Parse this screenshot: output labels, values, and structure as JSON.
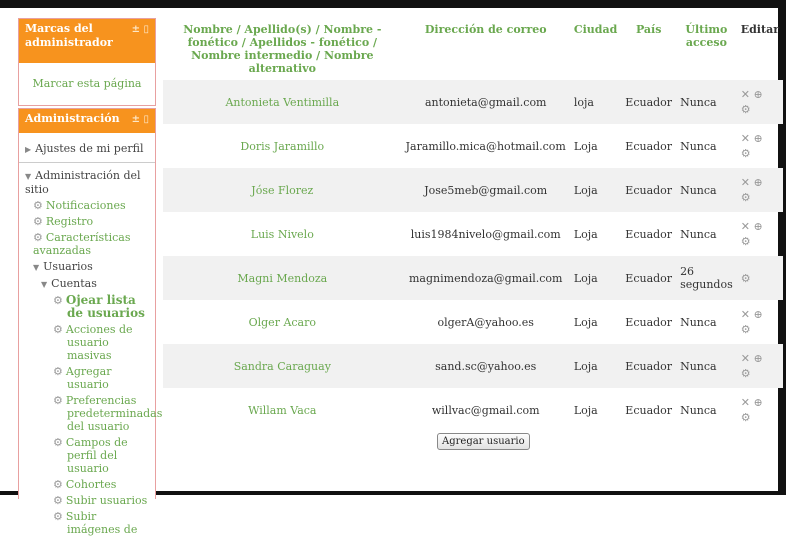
{
  "bookmarks_block": {
    "title": "Marcas del administrador",
    "controls": "± ▯",
    "link": "Marcar esta página"
  },
  "admin_block": {
    "title": "Administración",
    "controls": "± ▯",
    "profile_settings": "Ajustes de mi perfil",
    "site_admin": "Administración del sitio",
    "notifications": "Notificaciones",
    "registry": "Registro",
    "advanced": "Características avanzadas",
    "users": "Usuarios",
    "accounts": "Cuentas",
    "browse_users": "Ojear lista de usuarios",
    "bulk_actions": "Acciones de usuario masivas",
    "add_user": "Agregar usuario",
    "default_prefs": "Preferencias predeterminadas del usuario",
    "profile_fields": "Campos de perfil del usuario",
    "cohorts": "Cohortes",
    "upload_users": "Subir usuarios",
    "upload_pictures": "Subir imágenes de"
  },
  "table": {
    "headers": {
      "name": "Nombre / Apellido(s) / Nombre - fonético / Apellidos - fonético / Nombre intermedio / Nombre alternativo",
      "email": "Dirección de correo",
      "city": "Ciudad",
      "country": "País",
      "last_access": "Último acceso",
      "edit": "Editar"
    },
    "rows": [
      {
        "name": "Antonieta Ventimilla",
        "email": "antonieta@gmail.com",
        "city": "loja",
        "country": "Ecuador",
        "access": "Nunca",
        "edit1": "✕ ⊕",
        "edit2": "⚙"
      },
      {
        "name": "Doris Jaramillo",
        "email": "Jaramillo.mica@hotmail.com",
        "city": "Loja",
        "country": "Ecuador",
        "access": "Nunca",
        "edit1": "✕ ⊕",
        "edit2": "⚙"
      },
      {
        "name": "Jóse Florez",
        "email": "Jose5meb@gmail.com",
        "city": "Loja",
        "country": "Ecuador",
        "access": "Nunca",
        "edit1": "✕ ⊕",
        "edit2": "⚙"
      },
      {
        "name": "Luis Nivelo",
        "email": "luis1984nivelo@gmail.com",
        "city": "Loja",
        "country": "Ecuador",
        "access": "Nunca",
        "edit1": "✕ ⊕",
        "edit2": "⚙"
      },
      {
        "name": "Magni Mendoza",
        "email": "magnimendoza@gmail.com",
        "city": "Loja",
        "country": "Ecuador",
        "access": "26 segundos",
        "edit1": "⚙",
        "edit2": ""
      },
      {
        "name": "Olger Acaro",
        "email": "olgerA@yahoo.es",
        "city": "Loja",
        "country": "Ecuador",
        "access": "Nunca",
        "edit1": "✕ ⊕",
        "edit2": "⚙"
      },
      {
        "name": "Sandra Caraguay",
        "email": "sand.sc@yahoo.es",
        "city": "Loja",
        "country": "Ecuador",
        "access": "Nunca",
        "edit1": "✕ ⊕",
        "edit2": "⚙"
      },
      {
        "name": "Willam Vaca",
        "email": "willvac@gmail.com",
        "city": "Loja",
        "country": "Ecuador",
        "access": "Nunca",
        "edit1": "✕ ⊕",
        "edit2": "⚙"
      }
    ]
  },
  "add_user_button": "Agregar usuario"
}
